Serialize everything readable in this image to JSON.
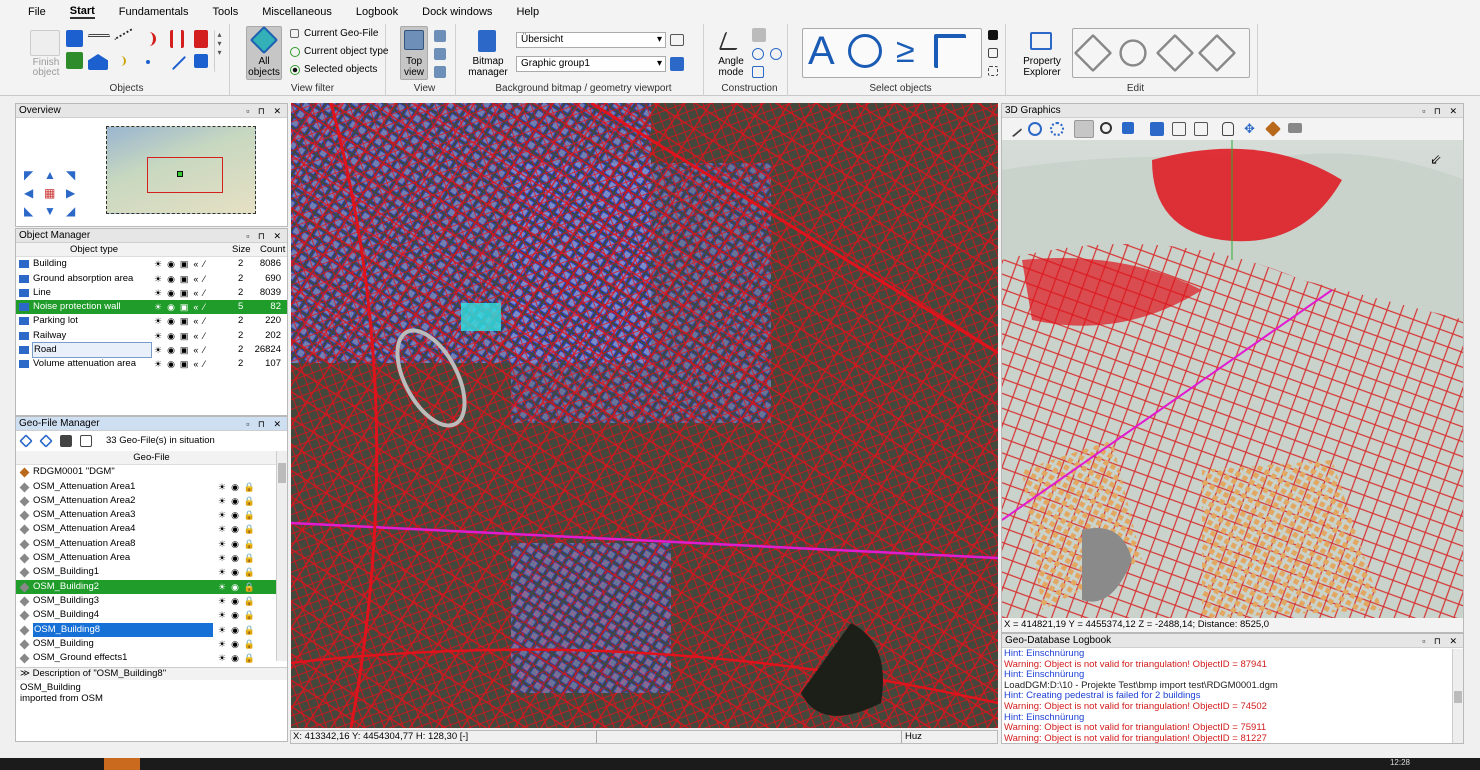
{
  "menubar": {
    "items": [
      "File",
      "Start",
      "Fundamentals",
      "Tools",
      "Miscellaneous",
      "Logbook",
      "Dock windows",
      "Help"
    ],
    "active": "Start"
  },
  "ribbon": {
    "groups": {
      "objects": "Objects",
      "view_filter": "View filter",
      "view": "View",
      "background": "Background bitmap / geometry viewport",
      "construction": "Construction",
      "select_objects": "Select objects",
      "edit": "Edit"
    },
    "finish_object": "Finish object",
    "all_objects": "All objects",
    "current_geo_file": "Current Geo-File",
    "current_object_type": "Current object type",
    "selected_objects": "Selected objects",
    "top_view": "Top view",
    "bitmap_manager": "Bitmap manager",
    "bitmap_select": "Übersicht",
    "graphic_group_select": "Graphic group1",
    "angle_mode": "Angle mode",
    "property_explorer": "Property Explorer",
    "select_symbols": [
      "A",
      "≥"
    ]
  },
  "overview": {
    "title": "Overview"
  },
  "object_manager": {
    "title": "Object Manager",
    "headers": {
      "type": "Object type",
      "size": "Size",
      "count": "Count"
    },
    "rows": [
      {
        "name": "Building",
        "size": "2",
        "count": "8086",
        "icon": "building-icon"
      },
      {
        "name": "Ground absorption area",
        "size": "2",
        "count": "690",
        "icon": "ground-icon"
      },
      {
        "name": "Line",
        "size": "2",
        "count": "8039",
        "icon": "line-icon"
      },
      {
        "name": "Noise protection wall",
        "size": "5",
        "count": "82",
        "icon": "wall-icon"
      },
      {
        "name": "Parking lot",
        "size": "2",
        "count": "220",
        "icon": "parking-icon"
      },
      {
        "name": "Railway",
        "size": "2",
        "count": "202",
        "icon": "railway-icon"
      },
      {
        "name": "Road",
        "size": "2",
        "count": "26824",
        "icon": "road-icon"
      },
      {
        "name": "Volume attenuation area",
        "size": "2",
        "count": "107",
        "icon": "volume-icon"
      }
    ]
  },
  "geo_file_manager": {
    "title": "Geo-File Manager",
    "count_text": "33 Geo-File(s) in situation",
    "header": "Geo-File",
    "rows": [
      "RDGM0001 \"DGM\"",
      "OSM_Attenuation Area1",
      "OSM_Attenuation Area2",
      "OSM_Attenuation Area3",
      "OSM_Attenuation Area4",
      "OSM_Attenuation Area8",
      "OSM_Attenuation Area",
      "OSM_Building1",
      "OSM_Building2",
      "OSM_Building3",
      "OSM_Building4",
      "OSM_Building8",
      "OSM_Building",
      "OSM_Ground effects1"
    ],
    "description_title": "Description of \"OSM_Building8\"",
    "description_lines": [
      "OSM_Building",
      "imported from OSM"
    ]
  },
  "graphics3d": {
    "title": "3D Graphics",
    "coords": "X = 414821,19   Y = 4455374,12   Z = -2488,14;   Distance: 8525,0"
  },
  "logbook": {
    "title": "Geo-Database Logbook",
    "lines": [
      {
        "type": "hint",
        "text": "Hint: Einschnürung"
      },
      {
        "type": "warn",
        "text": "Warning: Object is not valid for triangulation! ObjectID = 87941"
      },
      {
        "type": "hint",
        "text": "Hint: Einschnürung"
      },
      {
        "type": "info",
        "text": "LoadDGM:D:\\10 - Projekte Test\\bmp import test\\RDGM0001.dgm"
      },
      {
        "type": "hint",
        "text": "Hint: Creating pedestral is failed for 2 buildings"
      },
      {
        "type": "warn",
        "text": "Warning: Object is not valid for triangulation! ObjectID = 74502"
      },
      {
        "type": "hint",
        "text": "Hint: Einschnürung"
      },
      {
        "type": "warn",
        "text": "Warning: Object is not valid for triangulation! ObjectID = 75911"
      },
      {
        "type": "warn",
        "text": "Warning: Object is not valid for triangulation! ObjectID = 81227"
      }
    ]
  },
  "status": {
    "coords": "X: 413342,16   Y: 4454304,77    H: 128,30 [-]",
    "place": "Huz"
  },
  "taskbar": {
    "time": "12:28"
  },
  "colors": {
    "map_lines": "#e0121b",
    "buildings": "#2a3cd6",
    "highlight": "#1f9c2a",
    "select": "#1670d6"
  }
}
